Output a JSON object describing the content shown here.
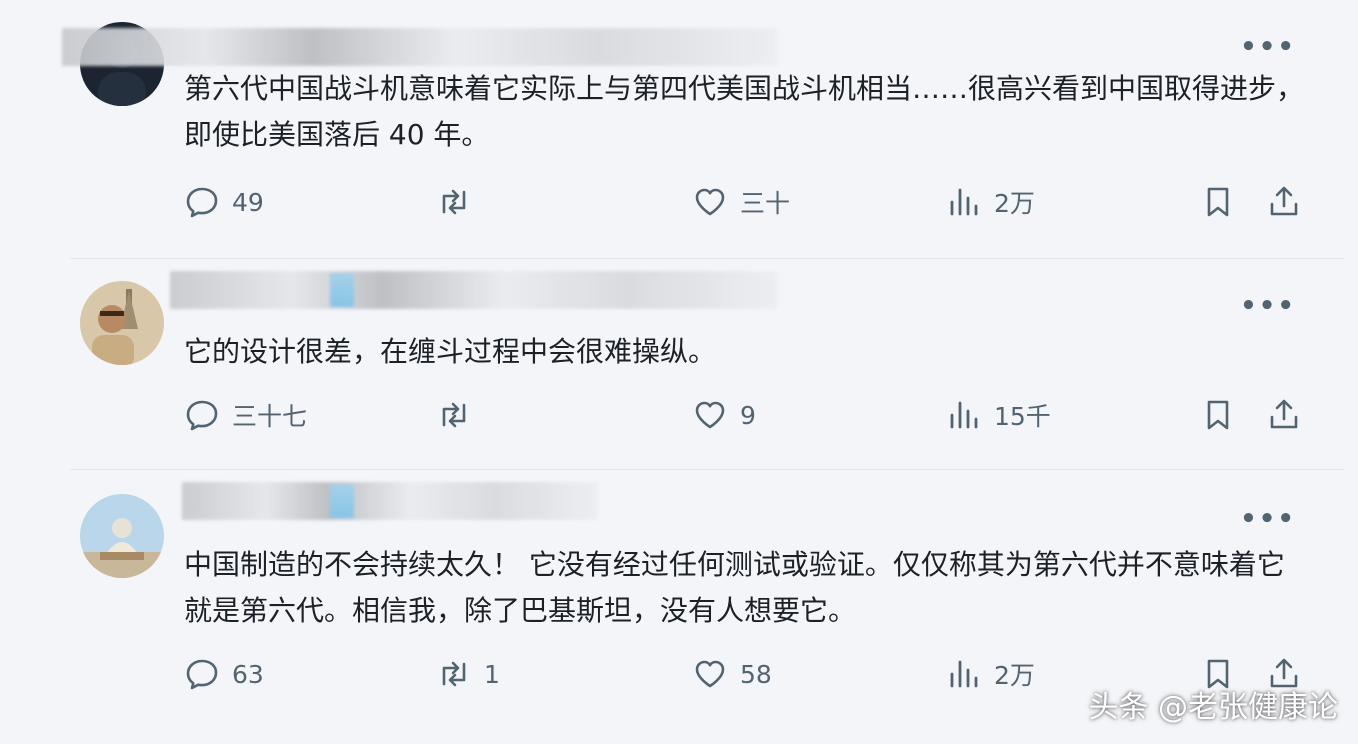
{
  "posts": [
    {
      "text": "第六代中国战斗机意味着它实际上与第四代美国战斗机相当……很高兴看到中国取得进步，即使比美国落后 40 年。",
      "replies": "49",
      "reposts": "",
      "likes": "三十",
      "views": "2万"
    },
    {
      "text": "它的设计很差，在缠斗过程中会很难操纵。",
      "replies": "三十七",
      "reposts": "",
      "likes": "9",
      "views": "15千"
    },
    {
      "text": "中国制造的不会持续太久！ 它没有经过任何测试或验证。仅仅称其为第六代并不意味着它就是第六代。相信我，除了巴基斯坦，没有人想要它。",
      "replies": "63",
      "reposts": "1",
      "likes": "58",
      "views": "2万"
    }
  ],
  "more_glyph": "•••",
  "icons": {
    "reply": "reply-icon",
    "repost": "repost-icon",
    "like": "heart-icon",
    "views": "views-icon",
    "bookmark": "bookmark-icon",
    "share": "share-icon",
    "more": "more-icon"
  },
  "watermark": "头条 @老张健康论"
}
